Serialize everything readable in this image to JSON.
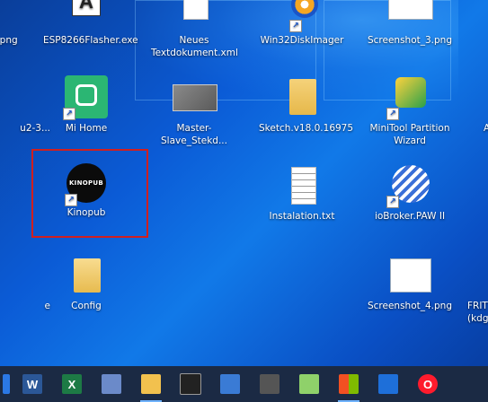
{
  "desktop_icons": [
    {
      "id": "png_partial",
      "label": ".png"
    },
    {
      "id": "esp8266",
      "label": "ESP8266Flasher.exe"
    },
    {
      "id": "neues_text",
      "label": "Neues Textdokument.xml"
    },
    {
      "id": "win32disk",
      "label": "Win32DiskImager"
    },
    {
      "id": "screenshot3",
      "label": "Screenshot_3.png"
    },
    {
      "id": "u2_partial",
      "label": "u2-3..."
    },
    {
      "id": "mihome",
      "label": "Mi Home"
    },
    {
      "id": "master_slave",
      "label": "Master-Slave_Stekd..."
    },
    {
      "id": "sketch",
      "label": "Sketch.v18.0.16975"
    },
    {
      "id": "minitool",
      "label": "MiniTool Partition Wizard"
    },
    {
      "id": "a_partial",
      "label": "A"
    },
    {
      "id": "kinopub",
      "label": "Kinopub",
      "logo_text": "KINOPUB"
    },
    {
      "id": "instalation",
      "label": "Instalation.txt"
    },
    {
      "id": "iobroker",
      "label": "ioBroker.PAW II"
    },
    {
      "id": "e_partial",
      "label": "e"
    },
    {
      "id": "config",
      "label": "Config"
    },
    {
      "id": "screenshot4",
      "label": "Screenshot_4.png"
    },
    {
      "id": "frit_partial",
      "label": "FRIT (kdg"
    }
  ],
  "taskbar": {
    "items": [
      {
        "icon": "app-icon",
        "text": ""
      },
      {
        "icon": "word-icon",
        "text": "W"
      },
      {
        "icon": "excel-icon",
        "text": "X"
      },
      {
        "icon": "tv-app-icon",
        "text": ""
      },
      {
        "icon": "file-explorer-icon",
        "text": ""
      },
      {
        "icon": "terminal-icon",
        "text": ""
      },
      {
        "icon": "network-icon",
        "text": ""
      },
      {
        "icon": "lock-app-icon",
        "text": ""
      },
      {
        "icon": "notepad-icon",
        "text": ""
      },
      {
        "icon": "store-icon",
        "text": ""
      },
      {
        "icon": "mail-icon",
        "text": ""
      },
      {
        "icon": "opera-icon",
        "text": "O"
      }
    ]
  },
  "colors": {
    "selection_border": "#d11f1f",
    "taskbar_bg": "#1b2a44",
    "desktop_blue": "#0b5bd6"
  }
}
